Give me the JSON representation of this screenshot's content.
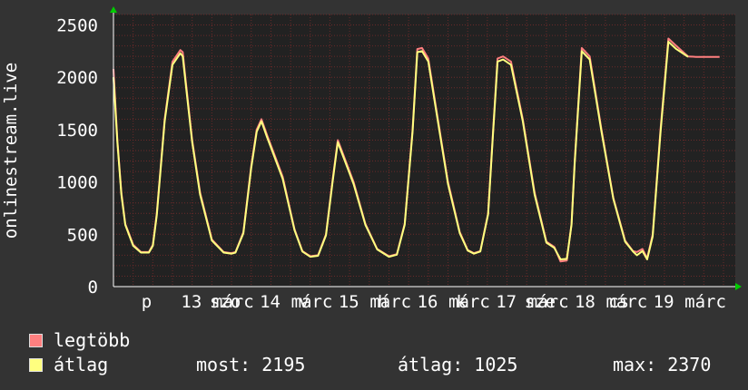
{
  "chart_data": {
    "type": "line",
    "ylabel": "onlinestream.live",
    "ylim": [
      0,
      2600
    ],
    "yticks": [
      0,
      500,
      1000,
      1500,
      2000,
      2500
    ],
    "xlim": [
      0,
      7.9
    ],
    "x_tick_labels": [
      "p",
      "13",
      "márc",
      "szo",
      "14",
      "márc",
      "v",
      "15",
      "márc",
      "h",
      "16",
      "márc",
      "k",
      "17",
      "márc",
      "sze",
      "18",
      "márc",
      "cs",
      "19",
      "márc"
    ],
    "grid": true,
    "series": [
      {
        "name": "legtöbb",
        "color": "#ff7f7f",
        "x": [
          0,
          0.05,
          0.1,
          0.15,
          0.25,
          0.35,
          0.45,
          0.5,
          0.55,
          0.65,
          0.75,
          0.85,
          0.88,
          0.92,
          1.0,
          1.1,
          1.25,
          1.4,
          1.5,
          1.55,
          1.65,
          1.75,
          1.82,
          1.88,
          1.95,
          2.05,
          2.15,
          2.3,
          2.4,
          2.5,
          2.6,
          2.7,
          2.78,
          2.85,
          2.95,
          3.05,
          3.2,
          3.35,
          3.5,
          3.6,
          3.7,
          3.8,
          3.86,
          3.92,
          4.0,
          4.1,
          4.25,
          4.4,
          4.5,
          4.58,
          4.66,
          4.76,
          4.82,
          4.88,
          4.95,
          5.05,
          5.2,
          5.35,
          5.5,
          5.6,
          5.68,
          5.76,
          5.82,
          5.86,
          5.95,
          6.05,
          6.2,
          6.35,
          6.5,
          6.6,
          6.65,
          6.72,
          6.78,
          6.85,
          6.95,
          7.05,
          7.15,
          7.3,
          7.4,
          7.5,
          7.57,
          7.63,
          7.7
        ],
        "values": [
          2080,
          1400,
          900,
          600,
          400,
          330,
          330,
          400,
          700,
          1600,
          2150,
          2260,
          2240,
          1950,
          1400,
          900,
          450,
          330,
          320,
          330,
          520,
          1150,
          1500,
          1600,
          1450,
          1250,
          1050,
          550,
          340,
          290,
          300,
          500,
          1000,
          1400,
          1200,
          1000,
          600,
          360,
          290,
          310,
          600,
          1500,
          2270,
          2280,
          2180,
          1700,
          1000,
          520,
          350,
          320,
          340,
          700,
          1450,
          2180,
          2200,
          2150,
          1600,
          900,
          430,
          380,
          240,
          250,
          600,
          1200,
          2280,
          2200,
          1500,
          850,
          440,
          340,
          330,
          360,
          270,
          500,
          1500,
          2370,
          2300,
          2200,
          2195,
          2195,
          2195,
          2195,
          2195
        ]
      },
      {
        "name": "átlag",
        "color": "#ffff7f",
        "x": [
          0,
          0.05,
          0.1,
          0.15,
          0.25,
          0.35,
          0.45,
          0.5,
          0.55,
          0.65,
          0.75,
          0.85,
          0.88,
          0.92,
          1.0,
          1.1,
          1.25,
          1.4,
          1.5,
          1.55,
          1.65,
          1.75,
          1.82,
          1.88,
          1.95,
          2.05,
          2.15,
          2.3,
          2.4,
          2.5,
          2.6,
          2.7,
          2.78,
          2.85,
          2.95,
          3.05,
          3.2,
          3.35,
          3.5,
          3.6,
          3.7,
          3.8,
          3.86,
          3.92,
          4.0,
          4.1,
          4.25,
          4.4,
          4.5,
          4.58,
          4.66,
          4.76,
          4.82,
          4.88,
          4.95,
          5.05,
          5.2,
          5.35,
          5.5,
          5.6,
          5.68,
          5.76,
          5.82,
          5.86,
          5.95,
          6.05,
          6.2,
          6.35,
          6.5,
          6.6,
          6.65,
          6.72,
          6.78,
          6.85,
          6.95,
          7.05,
          7.15,
          7.3
        ],
        "values": [
          2000,
          1380,
          880,
          590,
          390,
          325,
          325,
          390,
          680,
          1580,
          2120,
          2230,
          2200,
          1920,
          1380,
          880,
          440,
          325,
          315,
          325,
          510,
          1130,
          1480,
          1580,
          1430,
          1230,
          1030,
          540,
          335,
          285,
          295,
          490,
          980,
          1380,
          1180,
          980,
          590,
          355,
          285,
          305,
          590,
          1480,
          2240,
          2250,
          2150,
          1680,
          980,
          510,
          345,
          315,
          335,
          690,
          1430,
          2150,
          2170,
          2120,
          1580,
          880,
          420,
          370,
          260,
          265,
          590,
          1180,
          2250,
          2170,
          1480,
          840,
          430,
          335,
          300,
          340,
          260,
          480,
          1470,
          2340,
          2270,
          2195
        ]
      }
    ]
  },
  "legend": [
    {
      "label": "legtöbb",
      "color": "#ff7f7f"
    },
    {
      "label": "átlag",
      "color": "#ffff7f"
    }
  ],
  "stats": {
    "now": "most: 2195",
    "avg": "átlag: 1025",
    "max": "max: 2370"
  },
  "colors": {
    "background": "#333333",
    "plot_background": "#222222",
    "grid": "#6a2a2a",
    "axis": "#ffffff",
    "arrow": "#00cc00"
  }
}
